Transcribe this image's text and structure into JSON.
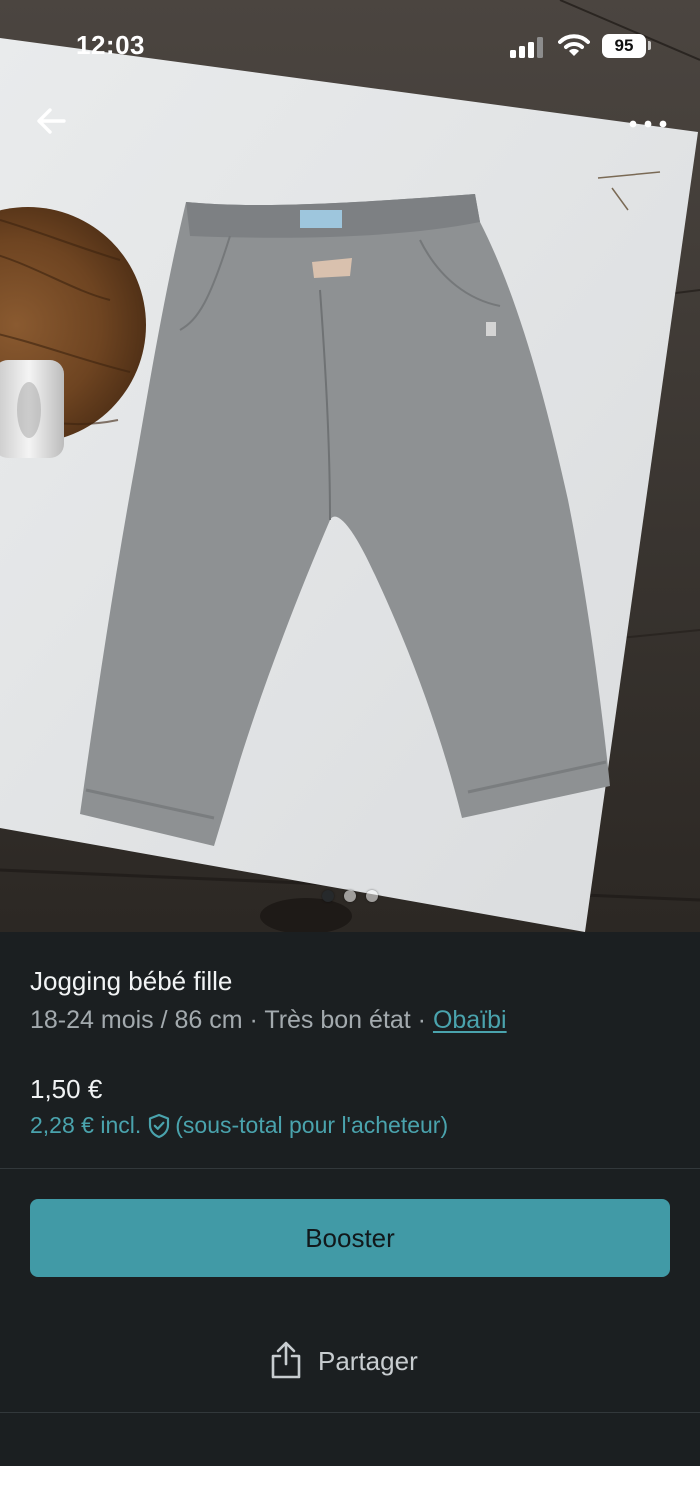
{
  "status_bar": {
    "time": "12:03",
    "battery": "95",
    "icons": [
      "signal-icon",
      "wifi-icon",
      "battery-icon"
    ]
  },
  "navigation": {
    "icons": [
      "back-arrow-icon",
      "more-options-icon"
    ]
  },
  "gallery": {
    "image_count": 3,
    "active_index": 0
  },
  "item": {
    "title": "Jogging bébé fille",
    "size": "18-24 mois / 86 cm",
    "separator": " · ",
    "condition": "Très bon état",
    "brand": "Obaïbi",
    "price": "1,50 €",
    "buyer_price": "2,28 € incl.",
    "buyer_note": "(sous-total pour l'acheteur)"
  },
  "actions": {
    "booster_label": "Booster",
    "share_label": "Partager"
  },
  "colors": {
    "accent": "#419aa6",
    "link": "#4aa3ad",
    "background": "#1b1f21"
  }
}
